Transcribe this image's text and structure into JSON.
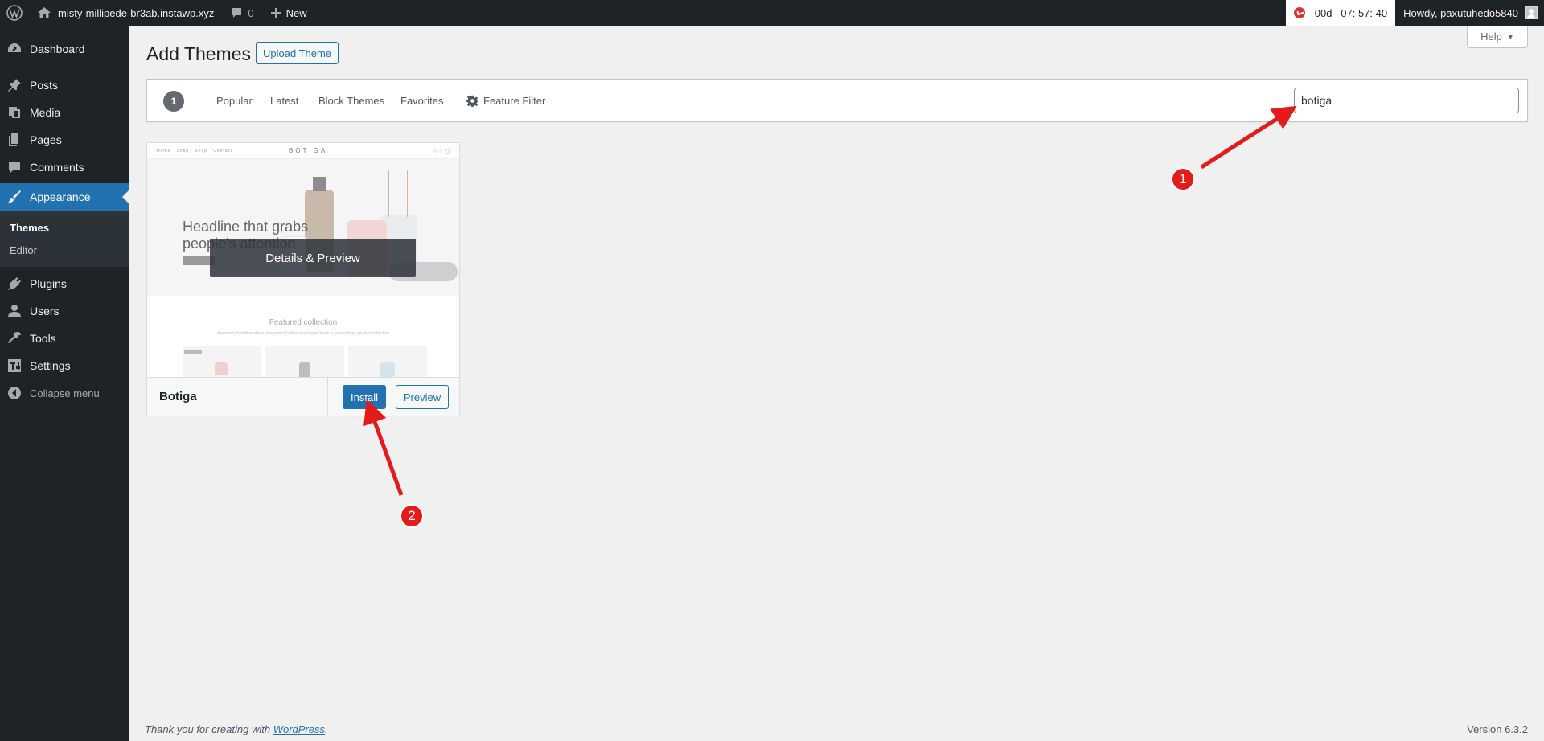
{
  "admin_bar": {
    "site_name": "misty-millipede-br3ab.instawp.xyz",
    "comments_count": "0",
    "new_label": "New",
    "timer": "00d   07: 57: 40",
    "howdy": "Howdy, paxutuhedo5840"
  },
  "sidebar": {
    "items": [
      {
        "label": "Dashboard",
        "icon": "dashboard-icon"
      },
      {
        "label": "Posts",
        "icon": "pin-icon"
      },
      {
        "label": "Media",
        "icon": "media-icon"
      },
      {
        "label": "Pages",
        "icon": "pages-icon"
      },
      {
        "label": "Comments",
        "icon": "comment-icon"
      },
      {
        "label": "Appearance",
        "icon": "brush-icon"
      },
      {
        "label": "Plugins",
        "icon": "plug-icon"
      },
      {
        "label": "Users",
        "icon": "user-icon"
      },
      {
        "label": "Tools",
        "icon": "wrench-icon"
      },
      {
        "label": "Settings",
        "icon": "settings-icon"
      }
    ],
    "submenu": [
      "Themes",
      "Editor"
    ],
    "collapse_label": "Collapse menu"
  },
  "header": {
    "help_label": "Help",
    "title": "Add Themes",
    "upload_label": "Upload Theme"
  },
  "filter": {
    "count": "1",
    "tabs": [
      "Popular",
      "Latest",
      "Block Themes",
      "Favorites"
    ],
    "feature_filter": "Feature Filter",
    "search_value": "botiga"
  },
  "theme": {
    "name": "Botiga",
    "details_label": "Details & Preview",
    "install_label": "Install",
    "preview_label": "Preview",
    "screenshot": {
      "nav_links": "Home   Shop   Shop   Contact",
      "brand": "BOTIGA",
      "headline_1": "Headline that grabs",
      "headline_2": "people's attention",
      "featured": "Featured collection",
      "featured_sub": "A powerful headline about your product's features to give focus to your chosen product collection"
    }
  },
  "footer": {
    "thanks_prefix": "Thank you for creating with ",
    "wordpress_link": "WordPress",
    "thanks_suffix": ".",
    "version": "Version 6.3.2"
  },
  "annotations": {
    "badge_1": "1",
    "badge_2": "2"
  },
  "colors": {
    "admin_bar": "#1d2327",
    "accent": "#2271b1",
    "annotation_red": "#e31b1b"
  }
}
